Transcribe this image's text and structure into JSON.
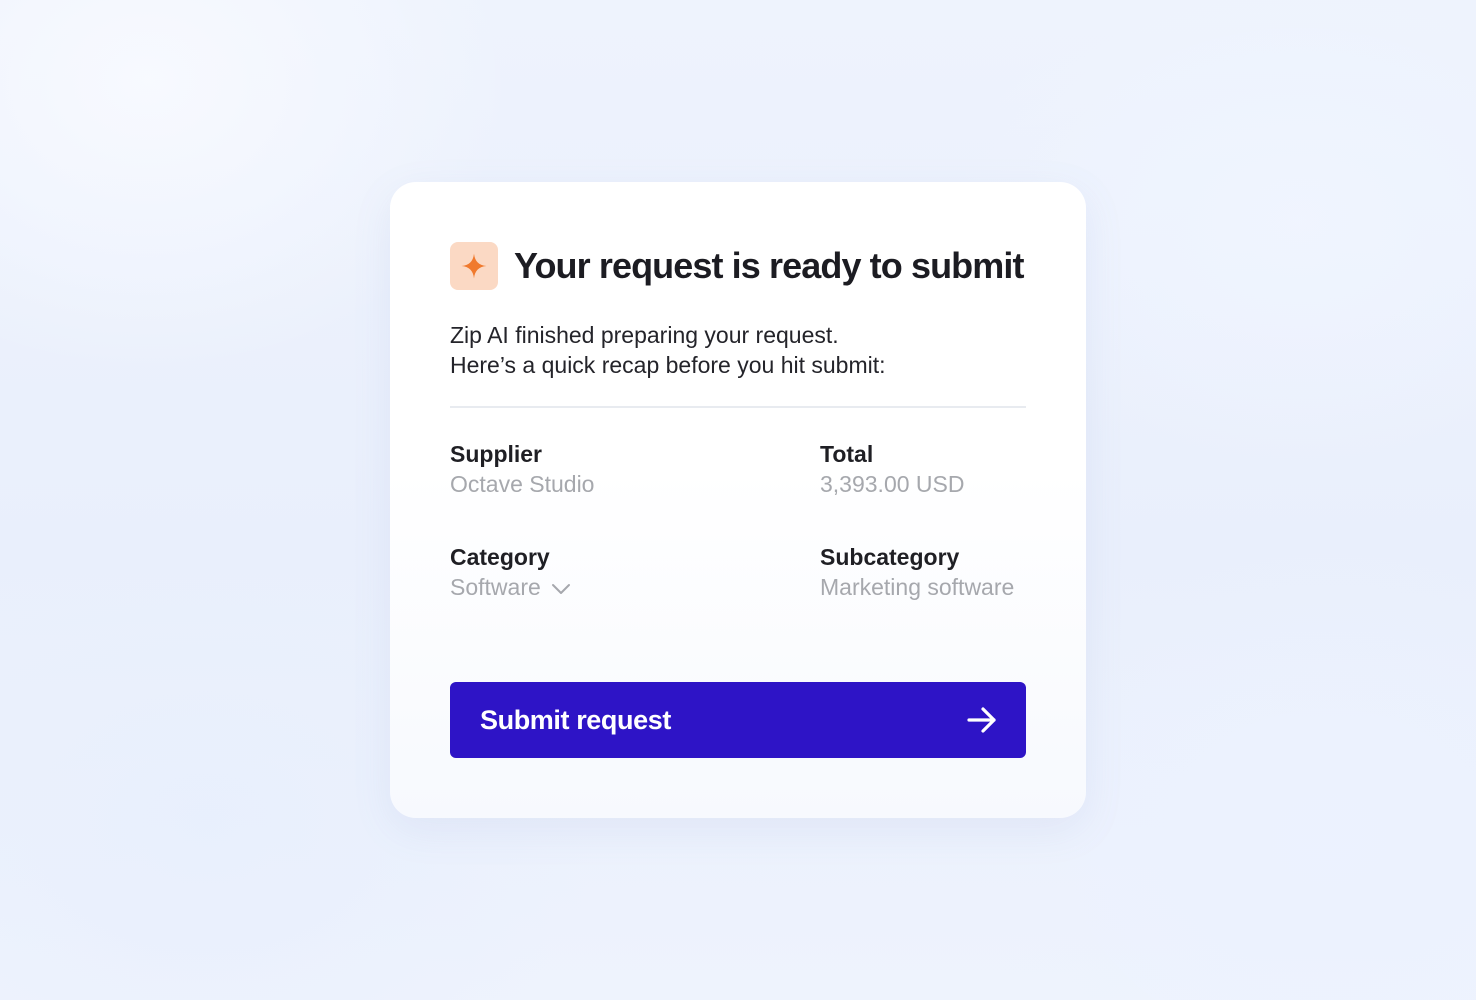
{
  "card": {
    "title": "Your request is ready to submit",
    "icon": "sparkle-icon",
    "intro_line1": "Zip AI finished preparing your request.",
    "intro_line2": "Here’s a quick recap before you hit submit:"
  },
  "fields": {
    "supplier": {
      "label": "Supplier",
      "value": "Octave Studio"
    },
    "total": {
      "label": "Total",
      "value": "3,393.00 USD"
    },
    "category": {
      "label": "Category",
      "value": "Software",
      "icon": "chevron-down-icon"
    },
    "subcategory": {
      "label": "Subcategory",
      "value": "Marketing software"
    }
  },
  "submit": {
    "label": "Submit request",
    "icon": "arrow-right-icon"
  },
  "colors": {
    "accent": "#2e14c6",
    "sparkle": "#f07a2e",
    "sparkle_bg": "#fbd9c4",
    "muted_value": "#a6a8ad"
  }
}
